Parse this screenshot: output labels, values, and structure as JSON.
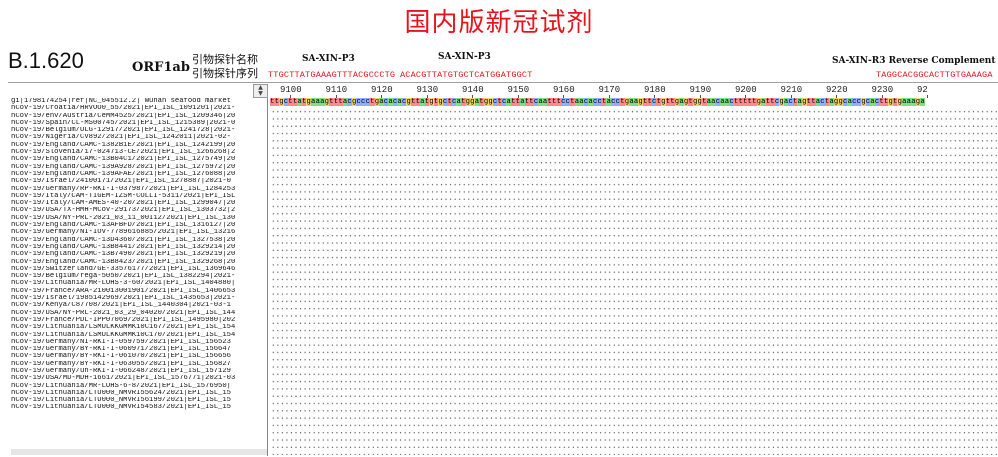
{
  "title": "国内版新冠试剂",
  "variant": "B.1.620",
  "gene": "ORF1ab",
  "labels": {
    "primer_name": "引物探针名称",
    "primer_seq": "引物探针序列"
  },
  "primers": [
    {
      "name": "SA-XIN-P3",
      "seq": "TTGCTTATGAAAGTTTACGCCCTG"
    },
    {
      "name": "SA-XIN-P3",
      "seq": "ACACGTTATGTGCTCATGGATGGCT"
    },
    {
      "name": "SA-XIN-R3 Reverse Complement",
      "seq": "TAGGCACGGCACTTGTGAAAGA"
    }
  ],
  "ruler": [
    "9100",
    "9110",
    "9120",
    "9130",
    "9140",
    "9150",
    "9160",
    "9170",
    "9180",
    "9190",
    "9200",
    "9210",
    "9220",
    "9230",
    "92"
  ],
  "reference_sequence": "ttgcttatgaaagtttacgccctgacacacgttatgtgctcatggatggctcattattcaatttcctaacacctacctgaagttctgttgagtggtaacaactttttgattcgactagttactaggcaccgcacttgtgaaaga",
  "sequence_names": [
    "gi|1798174254|ref|NC_045512.2| Wuhan seafood market",
    "hCoV-19/Croatia/HRVOO0_55/2021|EPI_ISL_1091201|2021-",
    "hCoV-19/env/Austria/CeMM4525/2021|EPI_ISL_1209346|20",
    "hCoV-19/Spain/CL-MS00745/2021|EPI_ISL_1215389|2021-0",
    "hCoV-19/Belgium/ULG-12917/2021|EPI_ISL_1241728|2021-",
    "hCoV-19/Nigeria/CV892/2021|EPI_ISL_1242011|2021-02-",
    "hCoV-19/England/CAMC-1382B1E/2021|EPI_ISL_1242199|20",
    "hCoV-19/Slovenia/17-024713-CE/2021|EPI_ISL_1266268|2",
    "hCoV-19/England/CAMC-13B04C1/2021|EPI_ISL_1275749|20",
    "hCoV-19/England/CAMC-139A928/2021|EPI_ISL_1275972|20",
    "hCoV-19/England/CAMC-139AFAE/2021|EPI_ISL_1276088|20",
    "hCoV-19/Israel/24100171/2021|EPI_ISL_1278887|2021-0",
    "hCoV-19/Germany/RP-RKI-I-037987/2021|EPI_ISL_1284253",
    "hCoV-19/Italy/CAM-TIGEM-IZSM-COLLI-5311/2021|EPI_ISL",
    "hCoV-19/Italy/CAM-AMES-40-20/2021|EPI_ISL_1299047|20",
    "hCoV-19/USA/TX-HMH-MCoV-29173/2021|EPI_ISL_1303732|2",
    "hCoV-19/USA/NY-PRL-2021_03_11_00I12/2021|EPI_ISL_130",
    "hCoV-19/England/CAMC-13AFBFD/2021|EPI_ISL_1316127|20",
    "hCoV-19/Germany/NI-IOV-7789616885/2021|EPI_ISL_13216",
    "hCoV-19/England/CAMC-13D4360/2021|EPI_ISL_1327538|20",
    "hCoV-19/England/CAMC-13B8441/2021|EPI_ISL_1329214|20",
    "hCoV-19/England/CAMC-13B7490/2021|EPI_ISL_1329219|20",
    "hCoV-19/England/CAMC-13B8423/2021|EPI_ISL_1329268|20",
    "hCoV-19/Switzerland/GE-33576177/2021|EPI_ISL_1369646",
    "hCoV-19/Belgium/rega-5050/2021|EPI_ISL_1382294|2021-",
    "hCoV-19/Lithuania/MR-LUHS-3-60/2021|EPI_ISL_1404880|",
    "hCoV-19/France/ARA-210013001901/2021|EPI_ISL_1406653",
    "hCoV-19/Israel/1985142969/2021|EPI_ISL_1435653|2021-",
    "hCoV-19/Kenya/C87708/2021|EPI_ISL_1440304|2021-03-1",
    "hCoV-19/USA/NY-PRL-2021_03_29_04020/2021|EPI_ISL_144",
    "hCoV-19/France/PDL-IPP07069/2021|EPI_ISL_1495980|202",
    "hCoV-19/Lithuania/LSMULKKGMMK10C167/2021|EPI_ISL_154",
    "hCoV-19/Lithuania/LSMULKKGMMK10C170/2021|EPI_ISL_154",
    "hCoV-19/Germany/NI-RKI-I-059759/2021|EPI_ISL_156523",
    "hCoV-19/Germany/BY-RKI-I-060971/2021|EPI_ISL_156647",
    "hCoV-19/Germany/BY-RKI-I-061070/2021|EPI_ISL_156656",
    "hCoV-19/Germany/BY-RKI-I-063055/2021|EPI_ISL_156827",
    "hCoV-19/Germany/un-RKI-I-066248/2021|EPI_ISL_157129",
    "hCoV-19/USA/MD-MDH-1661/2021|EPI_ISL_1576771|2021-03",
    "hCoV-19/Lithuania/MR-LUHS-6-8/2021|EPI_ISL_1576950|",
    "hCoV-19/Lithuania/LTU000_NMVRI55624/2021|EPI_ISL_15",
    "hCoV-19/Lithuania/LTU000_NMVRI56199/2021|EPI_ISL_15",
    "hCoV-19/Lithuania/LTU000_NMVRI54583/2021|EPI_ISL_15"
  ]
}
